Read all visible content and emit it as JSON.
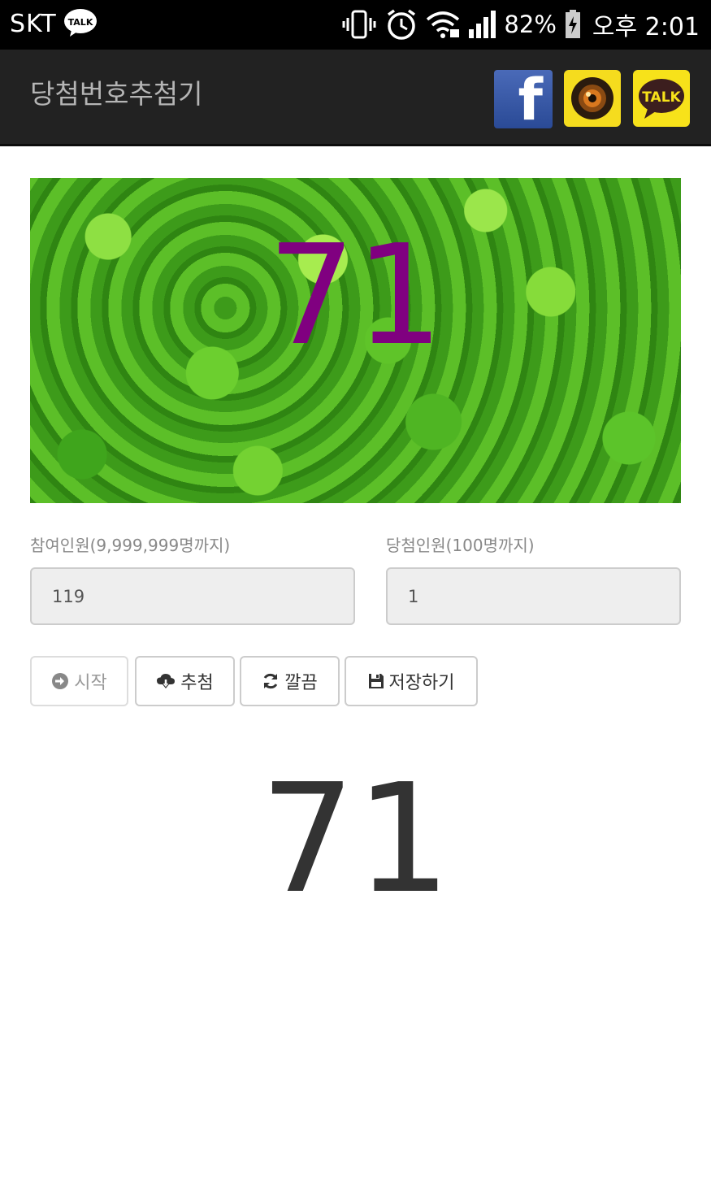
{
  "status_bar": {
    "carrier": "SKT",
    "notification_icon": "kakaotalk-icon",
    "notification_text": "TALK",
    "icons": [
      "vibrate-icon",
      "alarm-icon",
      "wifi-icon",
      "signal-icon"
    ],
    "battery": "82%",
    "battery_icon": "battery-charging-icon",
    "time": "오후 2:01"
  },
  "action_bar": {
    "title": "당첨번호추첨기",
    "share_buttons": [
      {
        "name": "facebook-share-button",
        "icon": "facebook-icon",
        "label": "f"
      },
      {
        "name": "kakaostory-share-button",
        "icon": "kakaostory-icon"
      },
      {
        "name": "kakaotalk-share-button",
        "icon": "kakaotalk-icon",
        "label": "TALK"
      }
    ]
  },
  "banner": {
    "number": "71",
    "number_color": "#800080"
  },
  "form": {
    "participants_label": "참여인원(9,999,999명까지)",
    "participants_value": "119",
    "winners_label": "당첨인원(100명까지)",
    "winners_value": "1"
  },
  "buttons": {
    "start": {
      "label": "시작",
      "icon": "arrow-circle-right-icon"
    },
    "draw": {
      "label": "추첨",
      "icon": "cloud-download-icon"
    },
    "clear": {
      "label": "깔끔",
      "icon": "refresh-icon"
    },
    "save": {
      "label": "저장하기",
      "icon": "floppy-disk-icon"
    }
  },
  "result": {
    "number": "71"
  },
  "colors": {
    "status_bar": "#000000",
    "action_bar": "#222222",
    "title_text": "#b5b5b5",
    "input_bg": "#eeeeee",
    "result_text": "#333333"
  }
}
